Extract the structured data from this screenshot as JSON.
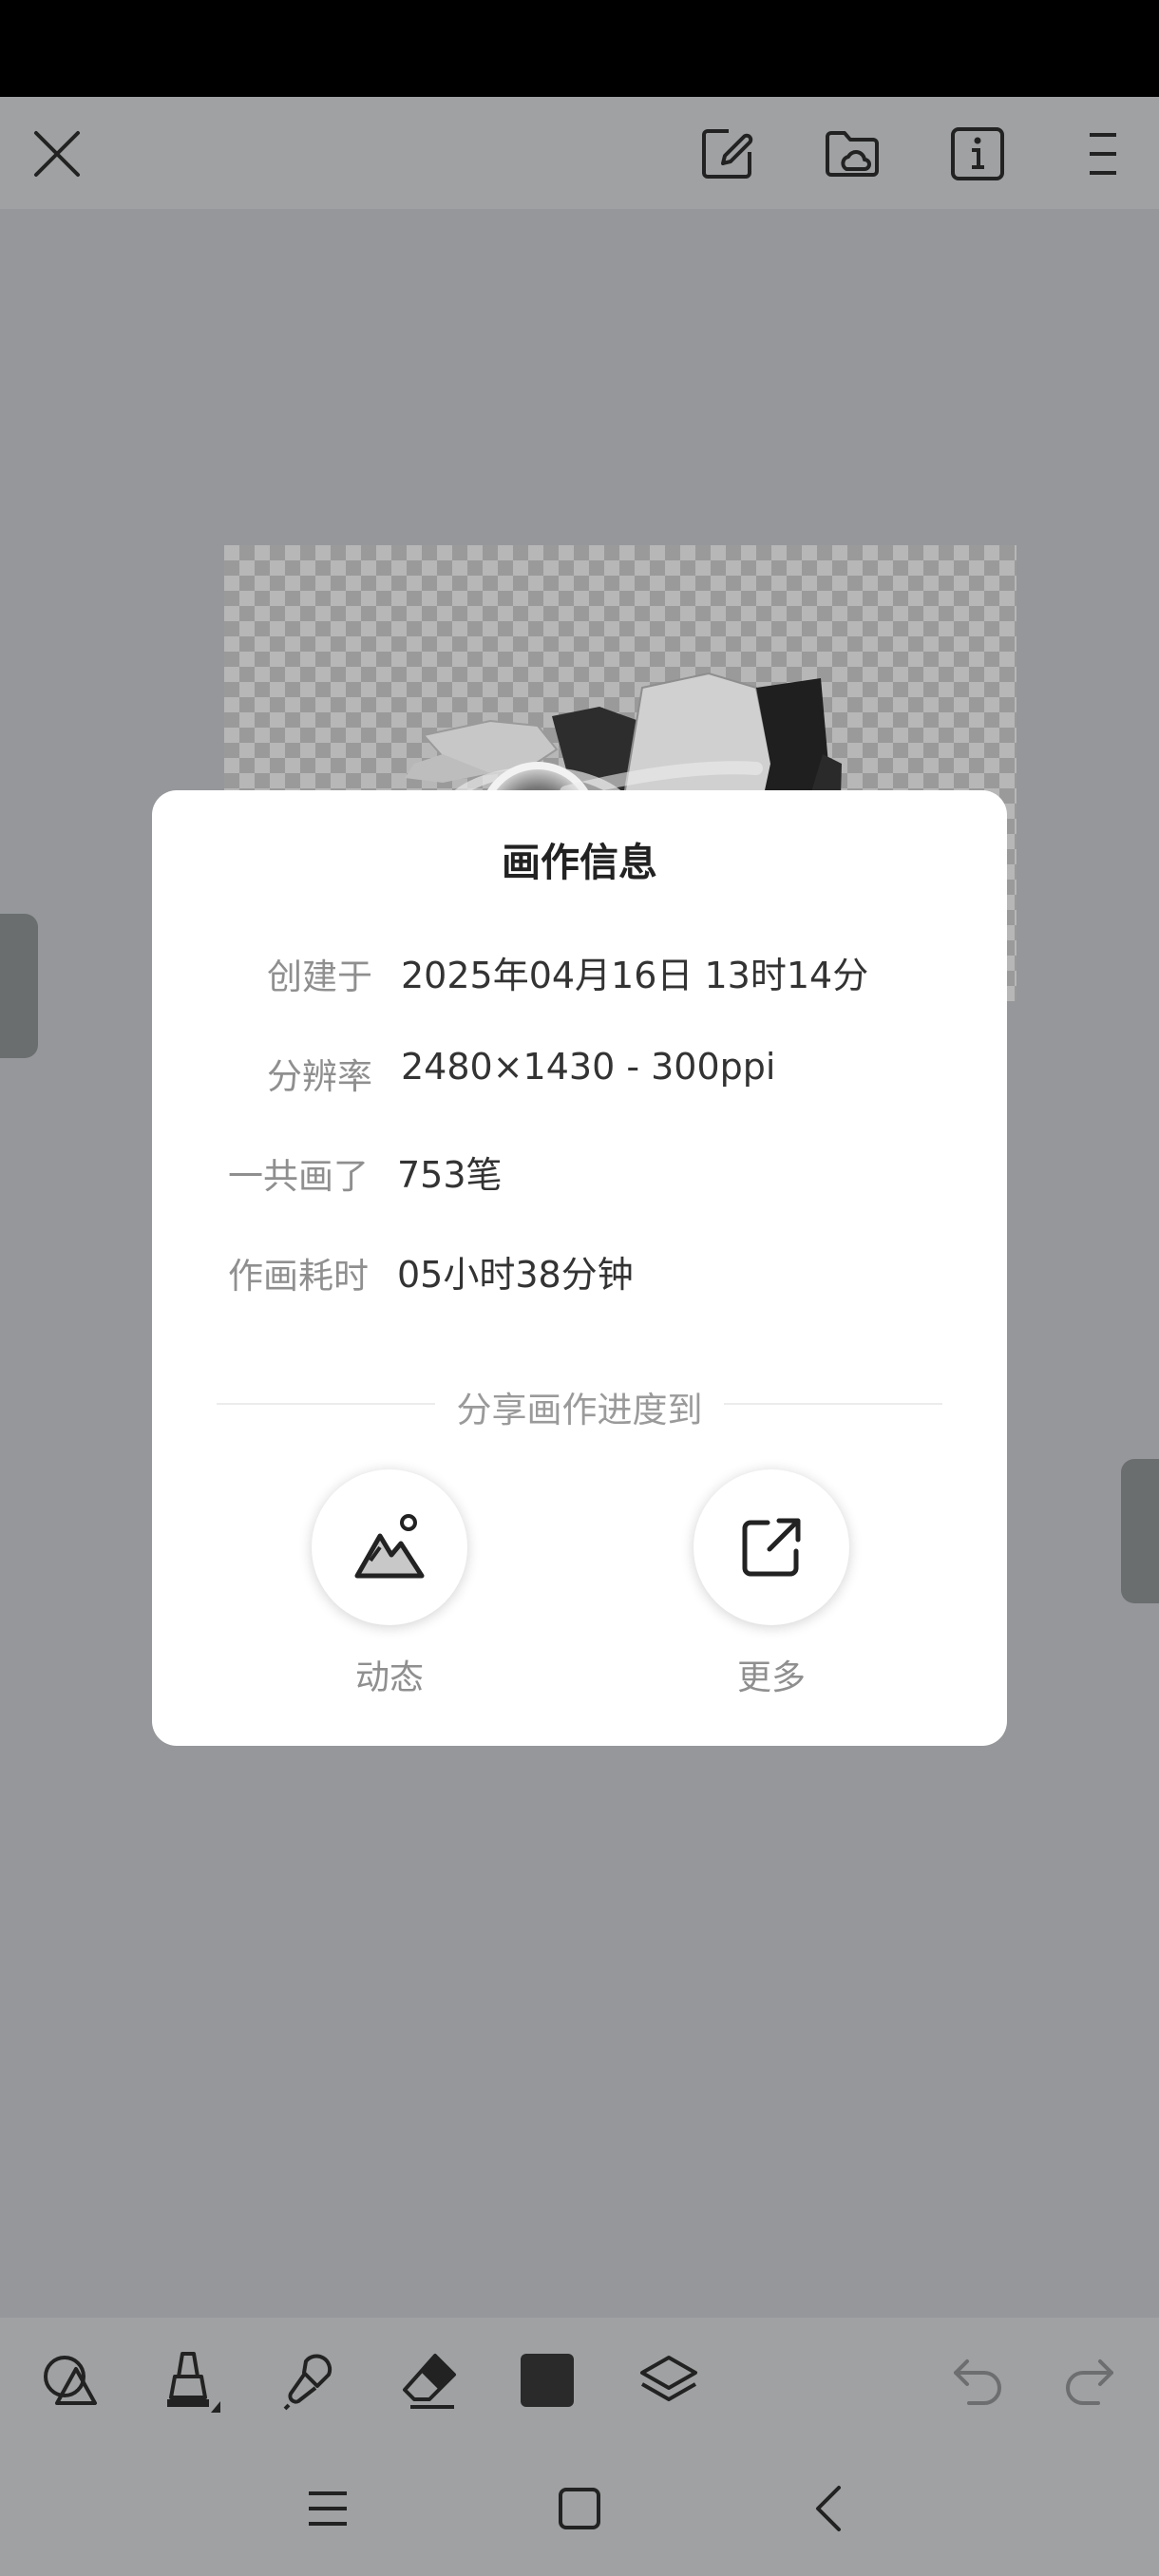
{
  "dialog": {
    "title": "画作信息",
    "created_label": "创建于",
    "created_value": "2025年04月16日 13时14分",
    "resolution_label": "分辨率",
    "resolution_value": "2480×1430 - 300ppi",
    "strokes_label": "一共画了",
    "strokes_value": "753笔",
    "time_label": "作画耗时",
    "time_value": "05小时38分钟",
    "share_heading": "分享画作进度到",
    "share_options": [
      {
        "label": "动态",
        "icon": "mountain-icon"
      },
      {
        "label": "更多",
        "icon": "external-share-icon"
      }
    ]
  },
  "top_toolbar": {
    "icons": [
      "close-icon",
      "edit-document-icon",
      "cloud-folder-icon",
      "info-icon",
      "menu-icon"
    ]
  },
  "bottom_toolbar": {
    "icons": [
      "shapes-icon",
      "marker-icon",
      "brush-icon",
      "eraser-icon",
      "color-swatch",
      "layers-icon",
      "undo-icon",
      "redo-icon"
    ],
    "selected_color": "#2a2a2a"
  },
  "nav_bar": {
    "icons": [
      "recents-icon",
      "home-icon",
      "back-icon"
    ]
  },
  "colors": {
    "background": "#95979a",
    "toolbar": "#9fa1a2",
    "dialog": "#ffffff"
  }
}
